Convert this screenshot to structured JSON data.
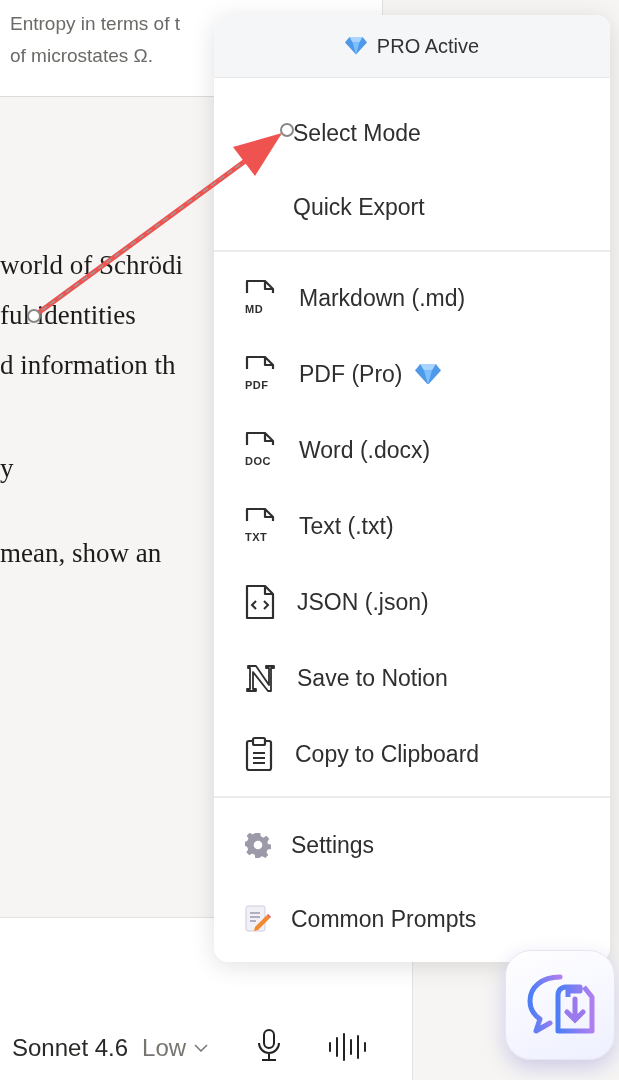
{
  "note_card": {
    "lines": [
      "Entropy in terms of t",
      "of microstates Ω."
    ]
  },
  "article": {
    "paragraphs": [
      [
        "world of Schrödi",
        "ful identities",
        "d information th"
      ],
      [
        "y"
      ],
      [
        "mean, show an"
      ]
    ]
  },
  "menu": {
    "header": {
      "label": "PRO Active"
    },
    "sections": [
      [
        {
          "kind": "plain",
          "label": "Select Mode"
        },
        {
          "kind": "plain",
          "label": "Quick Export"
        }
      ],
      [
        {
          "kind": "file",
          "badge": "MD",
          "label": "Markdown (.md)",
          "pro": false
        },
        {
          "kind": "file",
          "badge": "PDF",
          "label": "PDF (Pro)",
          "pro": true
        },
        {
          "kind": "file",
          "badge": "DOC",
          "label": "Word (.docx)",
          "pro": false
        },
        {
          "kind": "file",
          "badge": "TXT",
          "label": "Text (.txt)",
          "pro": false
        },
        {
          "kind": "code",
          "label": "JSON (.json)",
          "pro": false
        },
        {
          "kind": "notion",
          "label": "Save to Notion",
          "pro": false
        },
        {
          "kind": "clipboard",
          "label": "Copy to Clipboard",
          "pro": false
        }
      ],
      [
        {
          "kind": "settings",
          "label": "Settings"
        },
        {
          "kind": "prompts",
          "label": "Common Prompts"
        }
      ]
    ]
  },
  "composer": {
    "model": "Sonnet 4.6",
    "effort": "Low"
  }
}
